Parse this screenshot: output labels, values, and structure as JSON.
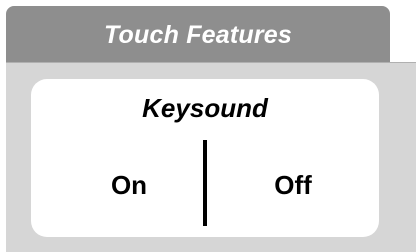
{
  "header": {
    "title": "Touch Features"
  },
  "keysound": {
    "title": "Keysound",
    "options": [
      {
        "label": "On"
      },
      {
        "label": "Off"
      }
    ]
  },
  "colors": {
    "tab_background": "#8e8e8e",
    "panel_background": "#d6d6d6",
    "card_background": "#ffffff",
    "text_dark": "#000000",
    "text_light": "#ffffff"
  }
}
